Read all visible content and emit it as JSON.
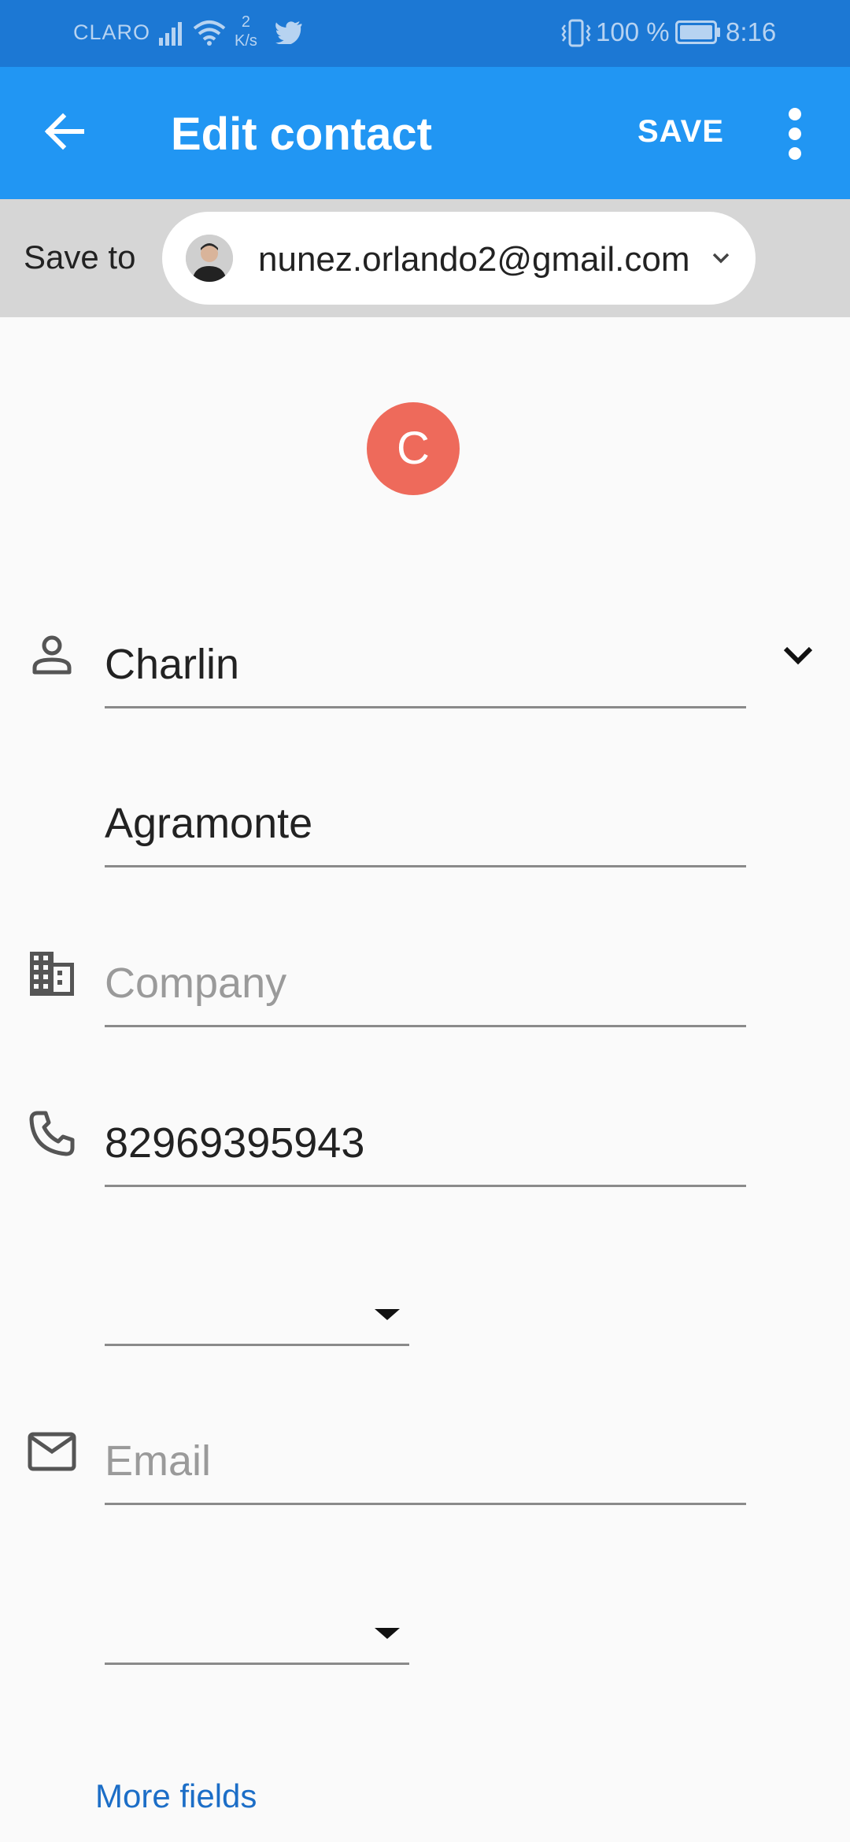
{
  "status_bar": {
    "carrier": "CLARO",
    "speed_value": "2",
    "speed_unit": "K/s",
    "battery_percent": "100 %",
    "time": "8:16"
  },
  "app_bar": {
    "title": "Edit contact",
    "save_label": "SAVE"
  },
  "save_to": {
    "label": "Save to",
    "account_email": "nunez.orlando2@gmail.com"
  },
  "contact": {
    "avatar_initial": "C",
    "first_name": "Charlin",
    "last_name": "Agramonte",
    "company_placeholder": "Company",
    "phone": "82969395943",
    "phone_type": "",
    "email_placeholder": "Email",
    "email_type": ""
  },
  "more_fields_label": "More fields",
  "colors": {
    "status_bar": "#1c78d4",
    "app_bar": "#2196f3",
    "avatar": "#ee6a5b",
    "link": "#1c6ec7"
  }
}
